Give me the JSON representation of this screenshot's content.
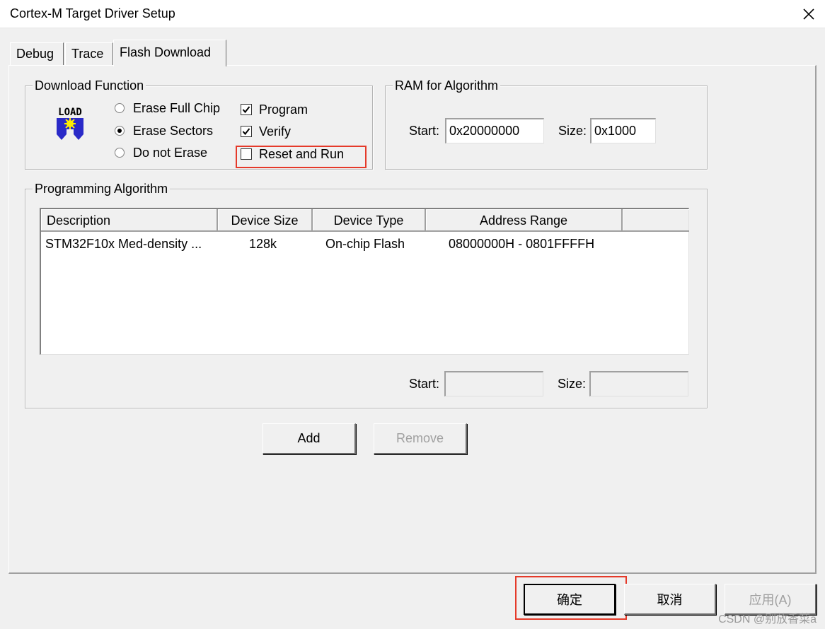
{
  "window": {
    "title": "Cortex-M Target Driver Setup"
  },
  "tabs": [
    {
      "label": "Debug"
    },
    {
      "label": "Trace"
    },
    {
      "label": "Flash Download"
    }
  ],
  "download_function": {
    "title": "Download Function",
    "icon_text": "LOAD",
    "erase_full_chip": "Erase Full Chip",
    "erase_sectors": "Erase Sectors",
    "do_not_erase": "Do not Erase",
    "program": "Program",
    "verify": "Verify",
    "reset_and_run": "Reset and Run"
  },
  "ram": {
    "title": "RAM for Algorithm",
    "start_label": "Start:",
    "start_value": "0x20000000",
    "size_label": "Size:",
    "size_value": "0x1000"
  },
  "programming_algorithm": {
    "title": "Programming Algorithm",
    "columns": [
      "Description",
      "Device Size",
      "Device Type",
      "Address Range"
    ],
    "rows": [
      [
        "STM32F10x Med-density ...",
        "128k",
        "On-chip Flash",
        "08000000H - 0801FFFFH"
      ]
    ],
    "start_label": "Start:",
    "start_value": "",
    "size_label": "Size:",
    "size_value": ""
  },
  "buttons": {
    "add": "Add",
    "remove": "Remove",
    "ok": "确定",
    "cancel": "取消",
    "apply": "应用(A)"
  },
  "watermark": "CSDN @别放香菜a",
  "colors": {
    "highlight": "#e53a2a",
    "panel": "#f0f0f0"
  }
}
